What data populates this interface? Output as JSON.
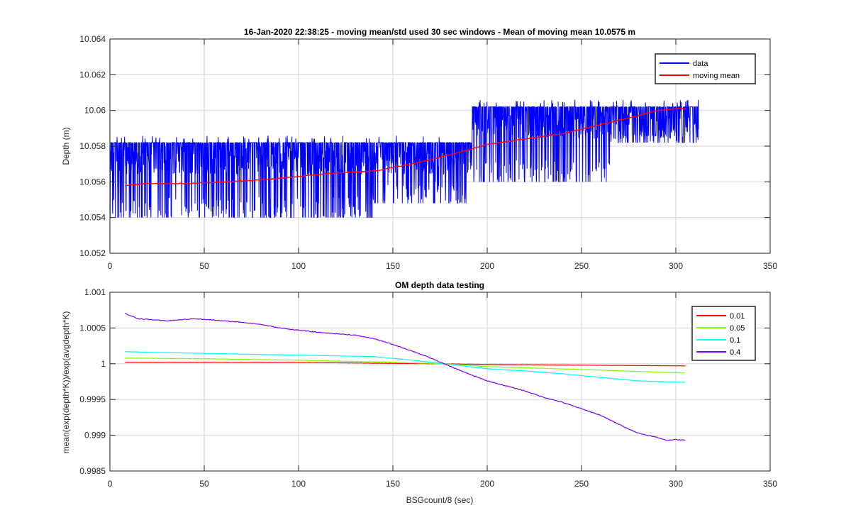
{
  "chart_data": [
    {
      "type": "line",
      "title": "16-Jan-2020 22:38:25 - moving mean/std used 30 sec windows - Mean of moving mean 10.0575 m",
      "xlabel": "",
      "ylabel": "Depth (m)",
      "xlim": [
        0,
        350
      ],
      "ylim": [
        10.052,
        10.064
      ],
      "xticks": [
        "0",
        "50",
        "100",
        "150",
        "200",
        "250",
        "300",
        "350"
      ],
      "yticks": [
        "10.052",
        "10.054",
        "10.056",
        "10.058",
        "10.06",
        "10.062",
        "10.064"
      ],
      "grid": true,
      "legend_position": "top-right",
      "series": [
        {
          "name": "data",
          "color": "#0000ff",
          "style": "noisy band",
          "x_range": [
            0,
            312
          ],
          "band_segments": [
            {
              "x": [
                0,
                140
              ],
              "low": 10.054,
              "high": 10.0582
            },
            {
              "x": [
                140,
                192
              ],
              "low": 10.0548,
              "high": 10.0582
            },
            {
              "x": [
                192,
                265
              ],
              "low": 10.056,
              "high": 10.0602
            },
            {
              "x": [
                265,
                312
              ],
              "low": 10.0582,
              "high": 10.0602
            }
          ]
        },
        {
          "name": "moving mean",
          "color": "#ff0000",
          "x": [
            8,
            20,
            40,
            60,
            80,
            100,
            120,
            140,
            160,
            180,
            200,
            220,
            240,
            260,
            280,
            290,
            300,
            305
          ],
          "y": [
            10.0558,
            10.0559,
            10.0559,
            10.056,
            10.0561,
            10.0563,
            10.0565,
            10.0566,
            10.057,
            10.0575,
            10.0581,
            10.0584,
            10.0587,
            10.0592,
            10.0597,
            10.06,
            10.0601,
            10.0601
          ]
        }
      ]
    },
    {
      "type": "line",
      "title": "OM depth data testing",
      "xlabel": "BSGcount/8 (sec)",
      "ylabel": "mean(exp(depth*K))/exp(avgdepth*K)",
      "xlim": [
        0,
        350
      ],
      "ylim": [
        0.9985,
        1.001
      ],
      "xticks": [
        "0",
        "50",
        "100",
        "150",
        "200",
        "250",
        "300",
        "350"
      ],
      "yticks": [
        "0.9985",
        "0.999",
        "0.9995",
        "1",
        "1.0005",
        "1.001"
      ],
      "grid": true,
      "legend_position": "top-right",
      "series": [
        {
          "name": "0.01",
          "color": "#ff0000",
          "x": [
            8,
            50,
            100,
            150,
            177,
            200,
            250,
            305
          ],
          "y": [
            1.00002,
            1.00002,
            1.00002,
            1.000005,
            1.0,
            0.99999,
            0.99998,
            0.99997
          ]
        },
        {
          "name": "0.05",
          "color": "#80ff00",
          "x": [
            8,
            50,
            100,
            150,
            177,
            200,
            250,
            305
          ],
          "y": [
            1.00008,
            1.00007,
            1.00005,
            1.00002,
            1.0,
            0.99996,
            0.99992,
            0.99987
          ]
        },
        {
          "name": "0.1",
          "color": "#00ffff",
          "x": [
            8,
            20,
            40,
            60,
            80,
            100,
            120,
            140,
            160,
            177,
            200,
            220,
            240,
            260,
            280,
            305
          ],
          "y": [
            1.00017,
            1.00016,
            1.00015,
            1.00014,
            1.00013,
            1.00012,
            1.00011,
            1.0001,
            1.00005,
            1.0,
            0.99993,
            0.9999,
            0.99986,
            0.99981,
            0.99976,
            0.99974
          ]
        },
        {
          "name": "0.4",
          "color": "#7f00ff",
          "x": [
            8,
            10,
            15,
            20,
            30,
            40,
            45,
            60,
            70,
            80,
            90,
            100,
            110,
            120,
            130,
            140,
            150,
            160,
            170,
            177,
            190,
            200,
            210,
            220,
            230,
            240,
            250,
            260,
            270,
            280,
            290,
            295,
            300,
            305
          ],
          "y": [
            1.00071,
            1.00068,
            1.00063,
            1.00062,
            1.0006,
            1.00062,
            1.00063,
            1.0006,
            1.00058,
            1.00055,
            1.0005,
            1.00047,
            1.00044,
            1.00042,
            1.0004,
            1.00035,
            1.00027,
            1.00018,
            1.00008,
            1.0,
            0.99986,
            0.99976,
            0.99969,
            0.99962,
            0.99953,
            0.99946,
            0.99937,
            0.99928,
            0.99915,
            0.99903,
            0.99897,
            0.99893,
            0.99894,
            0.99893
          ]
        }
      ]
    }
  ]
}
